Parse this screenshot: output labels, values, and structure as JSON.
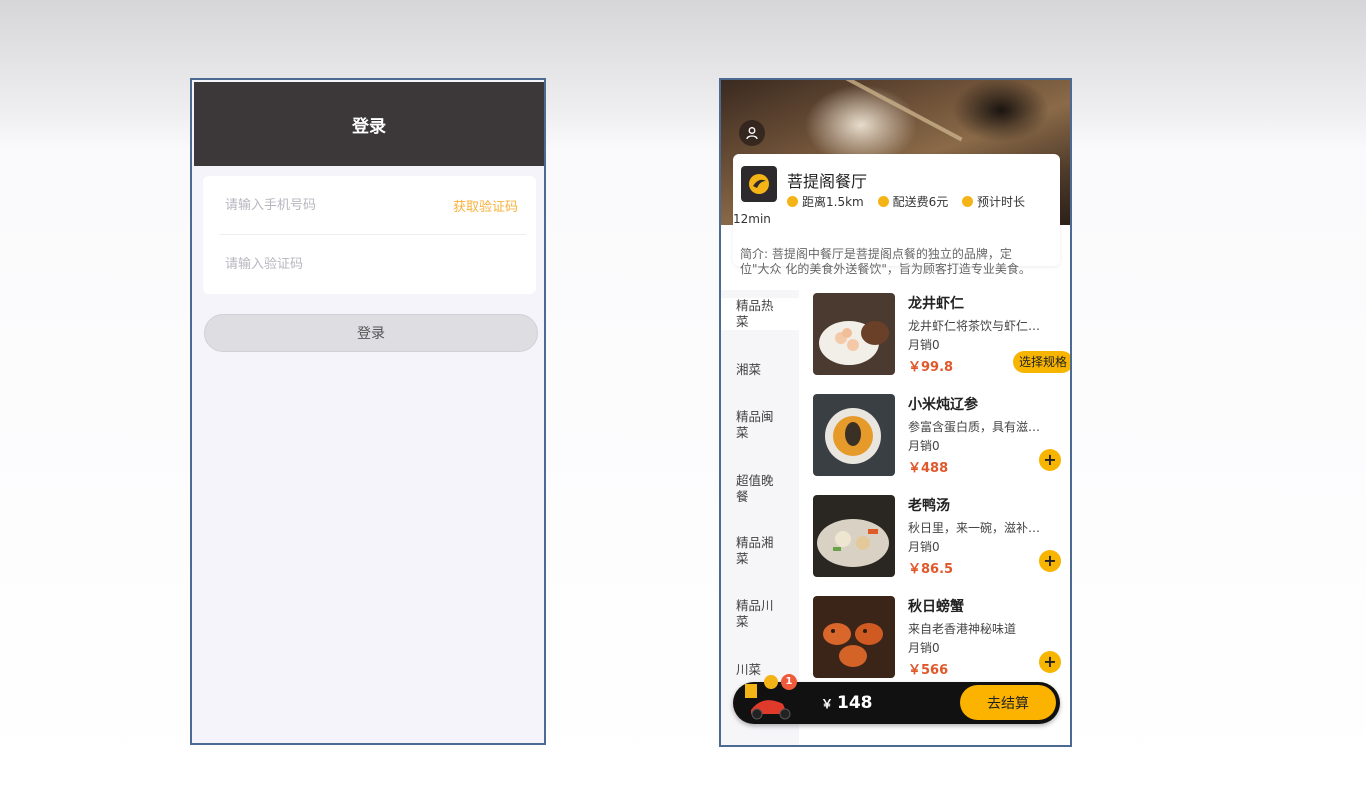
{
  "login": {
    "title": "登录",
    "phone_placeholder": "请输入手机号码",
    "get_code": "获取验证码",
    "code_placeholder": "请输入验证码",
    "submit": "登录"
  },
  "shop": {
    "name": "菩提阁餐厅",
    "distance": "距离1.5km",
    "delivery_fee": "配送费6元",
    "eta_label": "预计时长",
    "eta_value": "12min",
    "intro": "简介: 菩提阁中餐厅是菩提阁点餐的独立的品牌，定位\"大众 化的美食外送餐饮\"，旨为顾客打造专业美食。",
    "categories": [
      "精品热菜",
      "湘菜",
      "精品闽菜",
      "超值晚餐",
      "精品湘菜",
      "精品川菜",
      "川菜"
    ],
    "dishes": [
      {
        "name": "龙井虾仁",
        "desc": "龙井虾仁将茶饮与虾仁结合",
        "sales": "月销0",
        "price": "￥99.8",
        "action": "选择规格"
      },
      {
        "name": "小米炖辽参",
        "desc": "参富含蛋白质，具有滋补功效",
        "sales": "月销0",
        "price": "￥488",
        "action": "+"
      },
      {
        "name": "老鸭汤",
        "desc": "秋日里，来一碗，滋补又暖身",
        "sales": "月销0",
        "price": "￥86.5",
        "action": "+"
      },
      {
        "name": "秋日螃蟹",
        "desc": "来自老香港神秘味道",
        "sales": "月销0",
        "price": "￥566",
        "action": "+"
      }
    ],
    "cart": {
      "badge": "1",
      "currency": "￥",
      "total": "148",
      "checkout": "去结算"
    }
  },
  "colors": {
    "accent": "#f8b500",
    "price": "#e0582a",
    "header": "#3c383a"
  }
}
